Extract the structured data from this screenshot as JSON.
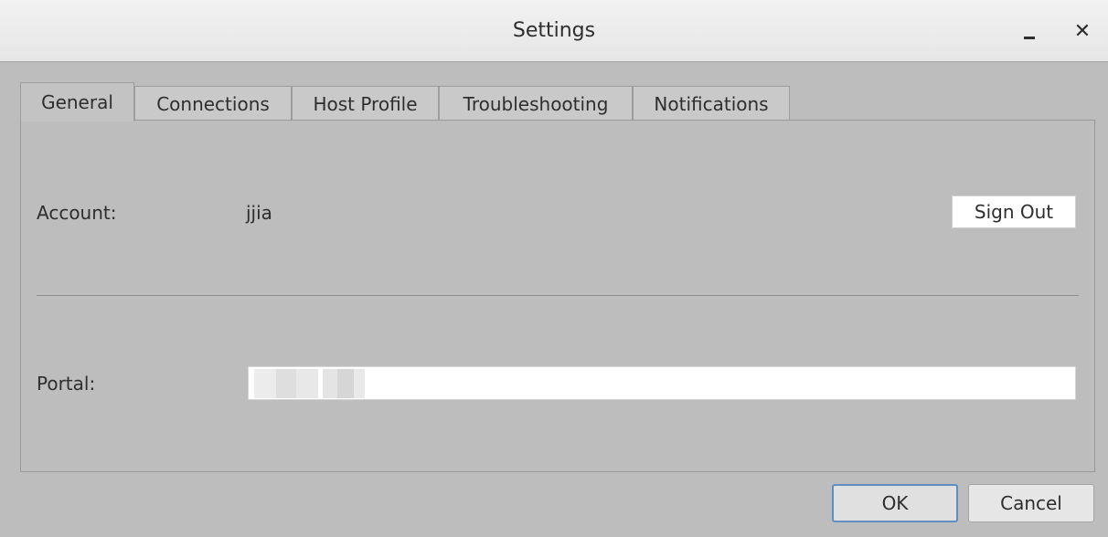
{
  "window": {
    "title": "Settings",
    "minimize_icon": "minimize-icon",
    "close_glyph": "✕"
  },
  "tabs": [
    {
      "label": "General",
      "active": true
    },
    {
      "label": "Connections",
      "active": false
    },
    {
      "label": "Host Profile",
      "active": false
    },
    {
      "label": "Troubleshooting",
      "active": false
    },
    {
      "label": "Notifications",
      "active": false
    }
  ],
  "general": {
    "account_label": "Account:",
    "account_value": "jjia",
    "sign_out_label": "Sign Out",
    "portal_label": "Portal:",
    "portal_value": ""
  },
  "footer": {
    "ok_label": "OK",
    "cancel_label": "Cancel"
  },
  "colors": {
    "background": "#bdbdbd",
    "titlebar": "#eeeeee",
    "ok_border": "#5f8fc0"
  }
}
